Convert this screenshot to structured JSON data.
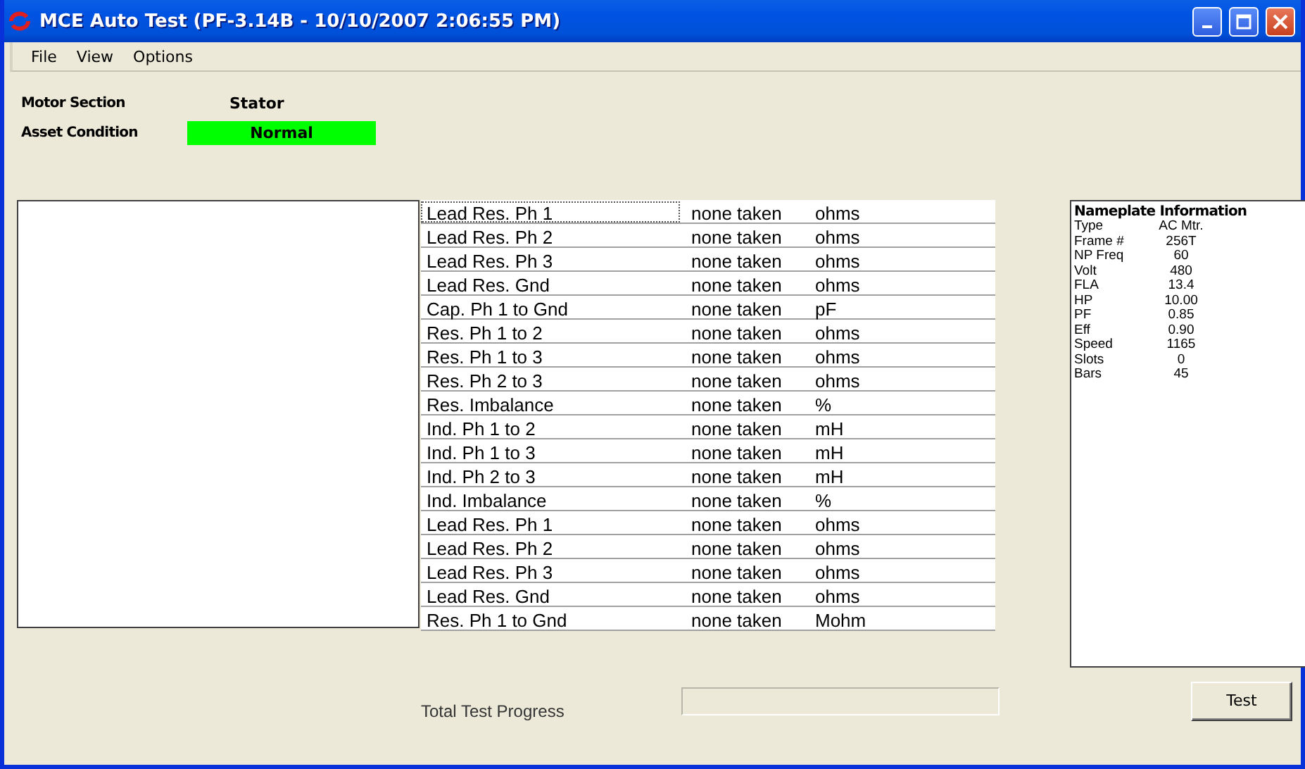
{
  "window": {
    "title": "MCE Auto Test (PF-3.14B - 10/10/2007 2:06:55 PM)"
  },
  "menu": [
    "File",
    "View",
    "Options"
  ],
  "info": {
    "motor_section_label": "Motor Section",
    "motor_section_value": "Stator",
    "asset_condition_label": "Asset Condition",
    "asset_condition": {
      "value": "Normal",
      "color": "#00ff00"
    }
  },
  "tests": [
    {
      "name": "Lead Res. Ph 1",
      "result": "none taken",
      "unit": "ohms",
      "selected": true
    },
    {
      "name": "Lead Res. Ph 2",
      "result": "none taken",
      "unit": "ohms",
      "selected": false
    },
    {
      "name": "Lead Res. Ph 3",
      "result": "none taken",
      "unit": "ohms",
      "selected": false
    },
    {
      "name": "Lead Res. Gnd",
      "result": "none taken",
      "unit": "ohms",
      "selected": false
    },
    {
      "name": "Cap. Ph 1 to Gnd",
      "result": "none taken",
      "unit": "pF",
      "selected": false
    },
    {
      "name": "Res. Ph 1 to 2",
      "result": "none taken",
      "unit": "ohms",
      "selected": false
    },
    {
      "name": "Res. Ph 1 to 3",
      "result": "none taken",
      "unit": "ohms",
      "selected": false
    },
    {
      "name": "Res. Ph 2 to 3",
      "result": "none taken",
      "unit": "ohms",
      "selected": false
    },
    {
      "name": "Res. Imbalance",
      "result": "none taken",
      "unit": "%",
      "selected": false
    },
    {
      "name": "Ind. Ph 1 to 2",
      "result": "none taken",
      "unit": "mH",
      "selected": false
    },
    {
      "name": "Ind. Ph 1 to 3",
      "result": "none taken",
      "unit": "mH",
      "selected": false
    },
    {
      "name": "Ind. Ph 2 to 3",
      "result": "none taken",
      "unit": "mH",
      "selected": false
    },
    {
      "name": "Ind. Imbalance",
      "result": "none taken",
      "unit": "%",
      "selected": false
    },
    {
      "name": "Lead Res. Ph 1",
      "result": "none taken",
      "unit": "ohms",
      "selected": false
    },
    {
      "name": "Lead Res. Ph 2",
      "result": "none taken",
      "unit": "ohms",
      "selected": false
    },
    {
      "name": "Lead Res. Ph 3",
      "result": "none taken",
      "unit": "ohms",
      "selected": false
    },
    {
      "name": "Lead Res. Gnd",
      "result": "none taken",
      "unit": "ohms",
      "selected": false
    },
    {
      "name": "Res. Ph 1 to Gnd",
      "result": "none taken",
      "unit": "Mohm",
      "selected": false
    }
  ],
  "nameplate": {
    "title": "Nameplate Information",
    "items": [
      {
        "label": "Type",
        "value": "AC Mtr."
      },
      {
        "label": "Frame #",
        "value": "256T"
      },
      {
        "label": "NP Freq",
        "value": "60"
      },
      {
        "label": "Volt",
        "value": "480"
      },
      {
        "label": "FLA",
        "value": "13.4"
      },
      {
        "label": "HP",
        "value": "10.00"
      },
      {
        "label": "PF",
        "value": "0.85"
      },
      {
        "label": "Eff",
        "value": "0.90"
      },
      {
        "label": "Speed",
        "value": "1165"
      },
      {
        "label": "Slots",
        "value": "0"
      },
      {
        "label": "Bars",
        "value": "45"
      }
    ]
  },
  "progress": {
    "label": "Total Test Progress",
    "level": 0
  },
  "buttons": [
    "Test"
  ]
}
